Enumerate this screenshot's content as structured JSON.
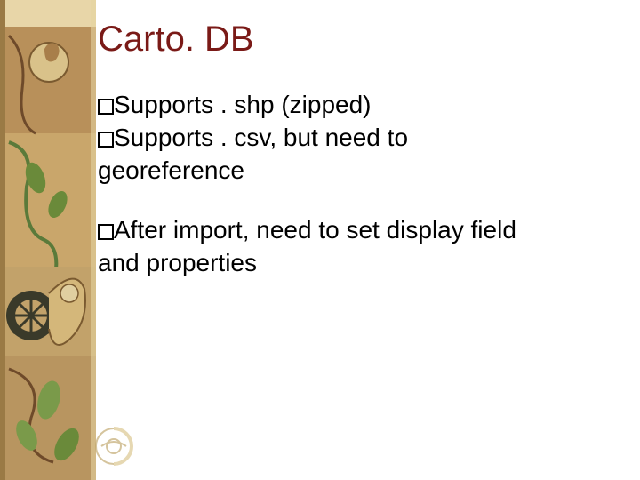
{
  "title": "Carto. DB",
  "bullets": {
    "g1": {
      "b1": "Supports . shp (zipped)",
      "b2_part1": "Supports . csv, but need to",
      "b2_cont": "georeference"
    },
    "g2": {
      "b1_part1": "After import, need to set display field",
      "b1_cont": "and properties"
    }
  }
}
